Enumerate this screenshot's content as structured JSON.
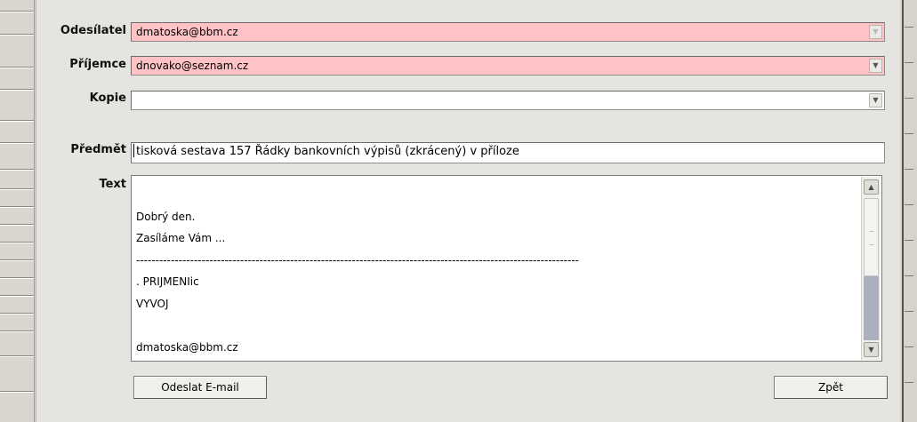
{
  "form": {
    "sender": {
      "label": "Odesílatel",
      "value": "dmatoska@bbm.cz"
    },
    "recipient": {
      "label": "Příjemce",
      "value": "dnovako@seznam.cz"
    },
    "copy": {
      "label": "Kopie",
      "value": ""
    },
    "subject": {
      "label": "Předmět",
      "value": "tisková sestava 157 Řádky bankovních výpisů (zkrácený) v příloze"
    },
    "text": {
      "label": "Text",
      "lines": [
        "",
        "Dobrý den.",
        "Zasíláme Vám ...",
        "-------------------------------------------------------------------------------------------------------------------",
        ". PRIJMENIic",
        "VYVOJ",
        "",
        "dmatoska@bbm.cz"
      ]
    }
  },
  "buttons": {
    "send": "Odeslat E-mail",
    "back": "Zpět"
  },
  "colors": {
    "required_field": "#ffc3c6",
    "scroll_track": "#aab0bd"
  },
  "icons": {
    "dropdown": "chevron-down-icon",
    "scroll_up": "arrow-up-icon",
    "scroll_down": "arrow-down-icon"
  }
}
